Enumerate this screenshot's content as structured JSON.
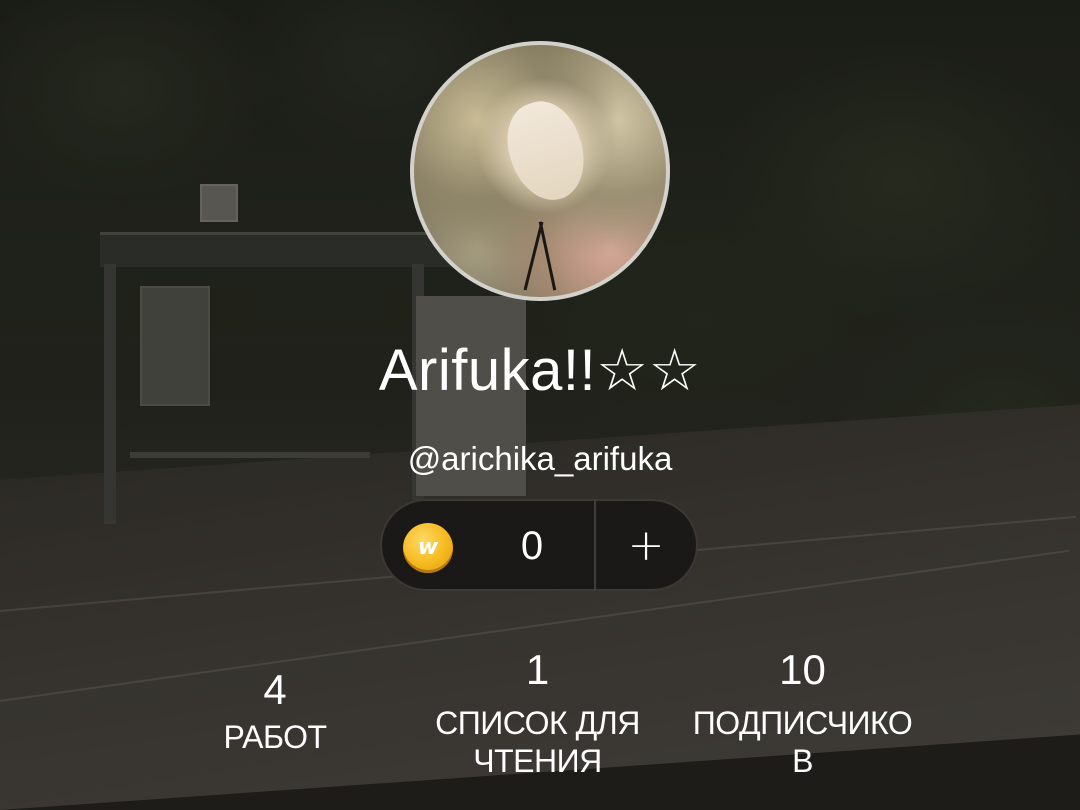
{
  "profile": {
    "display_name": "Arifuka!!☆☆",
    "username": "@arichika_arifuka"
  },
  "coins": {
    "icon": "wattpad-coin-icon",
    "icon_glyph": "w",
    "amount": "0",
    "add_label": "+"
  },
  "stats": {
    "works": {
      "value": "4",
      "label": "РАБОТ"
    },
    "reading_lists": {
      "value": "1",
      "label": "СПИСОК ДЛЯ\nЧТЕНИЯ"
    },
    "followers": {
      "value": "10",
      "label": "ПОДПИСЧИКО\nВ"
    }
  },
  "colors": {
    "coin": "#f5b91d",
    "pill_bg": "#1a1917",
    "text": "#ffffff"
  }
}
